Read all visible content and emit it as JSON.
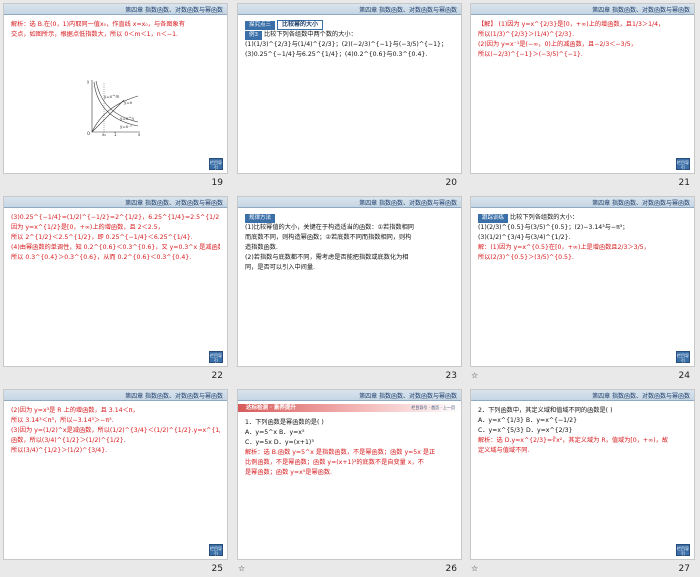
{
  "chapter_header": "第四章 指数函数、对数函数与幂函数",
  "corner_button_label": "栏目导引",
  "slides": [
    {
      "number": "19",
      "lines": [
        "解析：选 B.在(0，1)内取同一值x₀，作直线 x=x₀，与各图象有",
        "交点，如图所示，根据点低指数大，所以 0＜m＜1，n＜−1."
      ],
      "graph_labels": [
        "y=x^m",
        "y=x^n",
        "y=x",
        "y=x⁻¹",
        "O",
        "x₀",
        "1",
        "x",
        "y"
      ]
    },
    {
      "number": "20",
      "tag": "探究点三",
      "title": "比较幂的大小",
      "example": "例3",
      "lines": [
        "比较下列各组数中两个数的大小：",
        "(1)(1/3)^{2/3}与(1/4)^{2/3}；(2)(−2/3)^{−1}与(−3/5)^{−1}；",
        "(3)0.25^{−1/4}与6.25^{1/4}；(4)0.2^{0.6}与0.3^{0.4}."
      ]
    },
    {
      "number": "21",
      "lines": [
        "【解】 (1)因为 y=x^{2/3}是[0，+∞)上的增函数，且1/3＞1/4，",
        "所以(1/3)^{2/3}＞(1/4)^{2/3}.",
        "(2)因为 y=x⁻¹是(−∞，0)上的减函数，且−2/3＜−3/5，",
        "所以(−2/3)^{−1}＞(−3/5)^{−1}."
      ]
    },
    {
      "number": "22",
      "lines": [
        "(3)0.25^{−1/4}=(1/2)^{−1/2}=2^{1/2}，6.25^{1/4}=2.5^{1/2}.",
        "因为 y=x^{1/2}是[0，+∞)上的增函数，且 2＜2.5，",
        "所以 2^{1/2}＜2.5^{1/2}，即 0.25^{−1/4}＜6.25^{1/4}.",
        "(4)由幂函数的单调性，知 0.2^{0.6}＜0.3^{0.6}，又 y=0.3^x 是减函数，",
        "所以 0.3^{0.4}＞0.3^{0.6}，从而 0.2^{0.6}＜0.3^{0.4}."
      ]
    },
    {
      "number": "23",
      "tag": "规律方法",
      "lines": [
        "(1)比较幂值的大小，关键在于构造适当的函数：①若指数相同",
        "而底数不同，则构造幂函数；②若底数不同而指数相同，则构",
        "造指数函数.",
        "(2)若指数与底数都不同，需考虑是否能把指数或底数化为相",
        "同，是否可以引入中间量."
      ]
    },
    {
      "number": "24",
      "tag": "跟踪训练",
      "title": "比较下列各组数的大小：",
      "lines": [
        "(1)(2/3)^{0.5}与(3/5)^{0.5}；(2)−3.14³与−π³；",
        "(3)(1/2)^{3/4}与(3/4)^{1/2}.",
        "解：(1)因为 y=x^{0.5}在[0，+∞)上是增函数且2/3＞3/5，",
        "所以(2/3)^{0.5}＞(3/5)^{0.5}."
      ]
    },
    {
      "number": "25",
      "lines": [
        "(2)因为 y=x³是 R 上的增函数，且 3.14＜π，",
        "所以 3.14³＜π³，所以−3.14³＞−π³.",
        "(3)因为 y=(1/2)^x是减函数，所以(1/2)^{3/4}＜(1/2)^{1/2}.y=x^{1/2}是[0，+∞)上的增",
        "函数，所以(3/4)^{1/2}＞(1/2)^{1/2}.",
        "所以(3/4)^{1/2}＞(1/2)^{3/4}."
      ]
    },
    {
      "number": "26",
      "banner": "达标检测 · 素养提升",
      "banner_tabs": "栏目导引 · 首页 · 上一页",
      "lines": [
        "1．下列函数是幂函数的是(    )",
        "A．y=5^x          B．y=x⁵",
        "C．y=5x           D．y=(x+1)³",
        "解析：选 B.函数 y=5^x 是指数函数，不是幂函数；函数 y=5x 是正",
        "比例函数，不是幂函数；函数 y=(x+1)³的底数不是自变量 x，不",
        "是幂函数；函数 y=x⁵是幂函数."
      ]
    },
    {
      "number": "27",
      "lines": [
        "2．下列函数中，其定义域和值域不同的函数是(    )",
        "A．y=x^{1/3}          B．y=x^{−1/2}",
        "C．y=x^{5/3}          D．y=x^{2/3}",
        "解析：选 D.y=x^{2/3}=∛x²，其定义域为 R，值域为[0，+∞)，故",
        "定义域与值域不同."
      ]
    }
  ],
  "star_glyph": "☆",
  "colors": {
    "accent": "#3a6fa8",
    "text_red": "#d7191c"
  }
}
